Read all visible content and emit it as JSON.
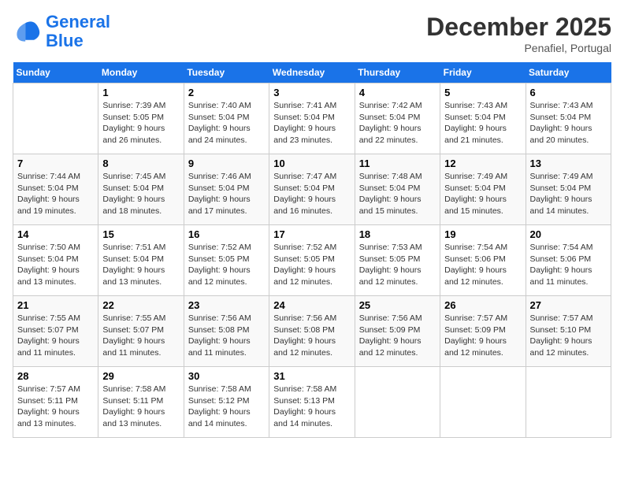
{
  "header": {
    "logo_line1": "General",
    "logo_line2": "Blue",
    "month": "December 2025",
    "location": "Penafiel, Portugal"
  },
  "weekdays": [
    "Sunday",
    "Monday",
    "Tuesday",
    "Wednesday",
    "Thursday",
    "Friday",
    "Saturday"
  ],
  "weeks": [
    [
      {
        "day": "",
        "content": ""
      },
      {
        "day": "1",
        "content": "Sunrise: 7:39 AM\nSunset: 5:05 PM\nDaylight: 9 hours\nand 26 minutes."
      },
      {
        "day": "2",
        "content": "Sunrise: 7:40 AM\nSunset: 5:04 PM\nDaylight: 9 hours\nand 24 minutes."
      },
      {
        "day": "3",
        "content": "Sunrise: 7:41 AM\nSunset: 5:04 PM\nDaylight: 9 hours\nand 23 minutes."
      },
      {
        "day": "4",
        "content": "Sunrise: 7:42 AM\nSunset: 5:04 PM\nDaylight: 9 hours\nand 22 minutes."
      },
      {
        "day": "5",
        "content": "Sunrise: 7:43 AM\nSunset: 5:04 PM\nDaylight: 9 hours\nand 21 minutes."
      },
      {
        "day": "6",
        "content": "Sunrise: 7:43 AM\nSunset: 5:04 PM\nDaylight: 9 hours\nand 20 minutes."
      }
    ],
    [
      {
        "day": "7",
        "content": "Sunrise: 7:44 AM\nSunset: 5:04 PM\nDaylight: 9 hours\nand 19 minutes."
      },
      {
        "day": "8",
        "content": "Sunrise: 7:45 AM\nSunset: 5:04 PM\nDaylight: 9 hours\nand 18 minutes."
      },
      {
        "day": "9",
        "content": "Sunrise: 7:46 AM\nSunset: 5:04 PM\nDaylight: 9 hours\nand 17 minutes."
      },
      {
        "day": "10",
        "content": "Sunrise: 7:47 AM\nSunset: 5:04 PM\nDaylight: 9 hours\nand 16 minutes."
      },
      {
        "day": "11",
        "content": "Sunrise: 7:48 AM\nSunset: 5:04 PM\nDaylight: 9 hours\nand 15 minutes."
      },
      {
        "day": "12",
        "content": "Sunrise: 7:49 AM\nSunset: 5:04 PM\nDaylight: 9 hours\nand 15 minutes."
      },
      {
        "day": "13",
        "content": "Sunrise: 7:49 AM\nSunset: 5:04 PM\nDaylight: 9 hours\nand 14 minutes."
      }
    ],
    [
      {
        "day": "14",
        "content": "Sunrise: 7:50 AM\nSunset: 5:04 PM\nDaylight: 9 hours\nand 13 minutes."
      },
      {
        "day": "15",
        "content": "Sunrise: 7:51 AM\nSunset: 5:04 PM\nDaylight: 9 hours\nand 13 minutes."
      },
      {
        "day": "16",
        "content": "Sunrise: 7:52 AM\nSunset: 5:05 PM\nDaylight: 9 hours\nand 12 minutes."
      },
      {
        "day": "17",
        "content": "Sunrise: 7:52 AM\nSunset: 5:05 PM\nDaylight: 9 hours\nand 12 minutes."
      },
      {
        "day": "18",
        "content": "Sunrise: 7:53 AM\nSunset: 5:05 PM\nDaylight: 9 hours\nand 12 minutes."
      },
      {
        "day": "19",
        "content": "Sunrise: 7:54 AM\nSunset: 5:06 PM\nDaylight: 9 hours\nand 12 minutes."
      },
      {
        "day": "20",
        "content": "Sunrise: 7:54 AM\nSunset: 5:06 PM\nDaylight: 9 hours\nand 11 minutes."
      }
    ],
    [
      {
        "day": "21",
        "content": "Sunrise: 7:55 AM\nSunset: 5:07 PM\nDaylight: 9 hours\nand 11 minutes."
      },
      {
        "day": "22",
        "content": "Sunrise: 7:55 AM\nSunset: 5:07 PM\nDaylight: 9 hours\nand 11 minutes."
      },
      {
        "day": "23",
        "content": "Sunrise: 7:56 AM\nSunset: 5:08 PM\nDaylight: 9 hours\nand 11 minutes."
      },
      {
        "day": "24",
        "content": "Sunrise: 7:56 AM\nSunset: 5:08 PM\nDaylight: 9 hours\nand 12 minutes."
      },
      {
        "day": "25",
        "content": "Sunrise: 7:56 AM\nSunset: 5:09 PM\nDaylight: 9 hours\nand 12 minutes."
      },
      {
        "day": "26",
        "content": "Sunrise: 7:57 AM\nSunset: 5:09 PM\nDaylight: 9 hours\nand 12 minutes."
      },
      {
        "day": "27",
        "content": "Sunrise: 7:57 AM\nSunset: 5:10 PM\nDaylight: 9 hours\nand 12 minutes."
      }
    ],
    [
      {
        "day": "28",
        "content": "Sunrise: 7:57 AM\nSunset: 5:11 PM\nDaylight: 9 hours\nand 13 minutes."
      },
      {
        "day": "29",
        "content": "Sunrise: 7:58 AM\nSunset: 5:11 PM\nDaylight: 9 hours\nand 13 minutes."
      },
      {
        "day": "30",
        "content": "Sunrise: 7:58 AM\nSunset: 5:12 PM\nDaylight: 9 hours\nand 14 minutes."
      },
      {
        "day": "31",
        "content": "Sunrise: 7:58 AM\nSunset: 5:13 PM\nDaylight: 9 hours\nand 14 minutes."
      },
      {
        "day": "",
        "content": ""
      },
      {
        "day": "",
        "content": ""
      },
      {
        "day": "",
        "content": ""
      }
    ]
  ]
}
